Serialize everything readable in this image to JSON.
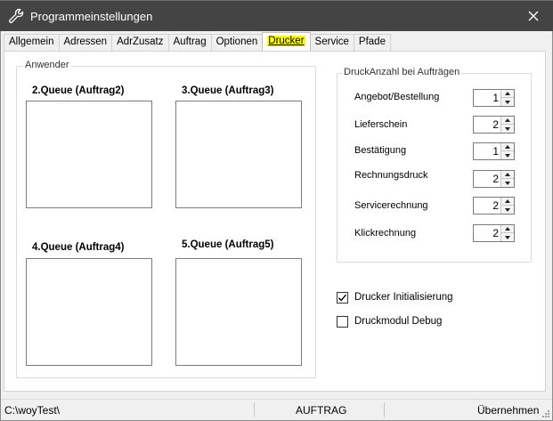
{
  "window": {
    "title": "Programmeinstellungen",
    "icon": "wrench-icon"
  },
  "tabs": [
    {
      "label": "Allgemein",
      "active": false
    },
    {
      "label": "Adressen",
      "active": false
    },
    {
      "label": "AdrZusatz",
      "active": false
    },
    {
      "label": "Auftrag",
      "active": false
    },
    {
      "label": "Optionen",
      "active": false
    },
    {
      "label": "Drucker",
      "active": true
    },
    {
      "label": "Service",
      "active": false
    },
    {
      "label": "Pfade",
      "active": false
    }
  ],
  "anwender": {
    "legend": "Anwender",
    "queues": [
      {
        "label": "2.Queue (Auftrag2)"
      },
      {
        "label": "3.Queue (Auftrag3)"
      },
      {
        "label": "4.Queue (Auftrag4)"
      },
      {
        "label": "5.Queue (Auftrag5)"
      }
    ]
  },
  "druckanzahl": {
    "legend": "DruckAnzahl  bei Aufträgen",
    "rows": [
      {
        "label": "Angebot/Bestellung",
        "value": "1"
      },
      {
        "label": "Lieferschein",
        "value": "2"
      },
      {
        "label": "Bestätigung",
        "value": "1"
      },
      {
        "label": "Rechnungsdruck",
        "value": "2"
      },
      {
        "label": "Servicerechnung",
        "value": "2"
      },
      {
        "label": "Klickrechnung",
        "value": "2"
      }
    ]
  },
  "options": {
    "drucker_init": {
      "label": "Drucker Initialisierung",
      "checked": true
    },
    "druckmodul_debug": {
      "label": "Druckmodul Debug",
      "checked": false
    }
  },
  "statusbar": {
    "path": "C:\\woyTest\\",
    "module": "AUFTRAG",
    "action": "Übernehmen"
  }
}
